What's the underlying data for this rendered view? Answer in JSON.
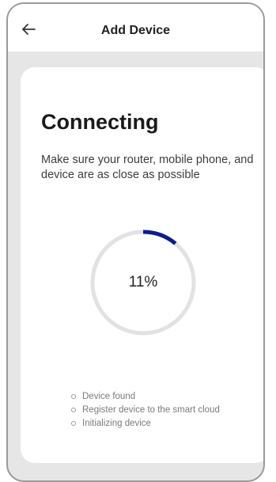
{
  "header": {
    "back_icon": "arrow-left-icon",
    "title": "Add Device"
  },
  "main": {
    "title": "Connecting",
    "subtitle": "Make sure your router, mobile phone, and device are as close as possible",
    "progress": {
      "value": 0.11,
      "label": "11%",
      "track_color": "#e2e2e2",
      "fill_color": "#0d1c8c"
    },
    "steps": [
      {
        "label": "Device found"
      },
      {
        "label": "Register device to the smart cloud"
      },
      {
        "label": "Initializing device"
      }
    ]
  },
  "colors": {
    "background": "#e6e6e6",
    "card": "#ffffff",
    "accent": "#0d1c8c"
  }
}
